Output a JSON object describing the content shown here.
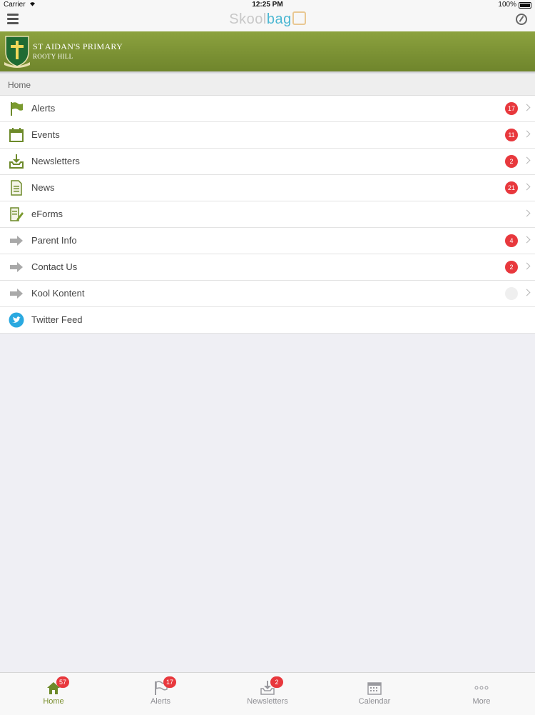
{
  "status_bar": {
    "carrier": "Carrier",
    "time": "12:25 PM",
    "battery": "100%"
  },
  "header": {
    "logo_part1": "Skool",
    "logo_part2": "bag"
  },
  "school": {
    "name": "ST AIDAN'S PRIMARY",
    "location": "ROOTY HILL"
  },
  "breadcrumb": "Home",
  "menu": [
    {
      "label": "Alerts",
      "badge": "17",
      "icon": "flag-icon"
    },
    {
      "label": "Events",
      "badge": "11",
      "icon": "calendar-icon"
    },
    {
      "label": "Newsletters",
      "badge": "2",
      "icon": "inbox-download-icon"
    },
    {
      "label": "News",
      "badge": "21",
      "icon": "document-icon"
    },
    {
      "label": "eForms",
      "badge": "",
      "icon": "form-edit-icon"
    },
    {
      "label": "Parent Info",
      "badge": "4",
      "icon": "arrow-right-icon"
    },
    {
      "label": "Contact Us",
      "badge": "2",
      "icon": "arrow-right-icon"
    },
    {
      "label": "Kool Kontent",
      "badge": "",
      "icon": "arrow-right-icon"
    },
    {
      "label": "Twitter Feed",
      "badge": "",
      "icon": "twitter-bird-icon"
    }
  ],
  "tabbar": [
    {
      "label": "Home",
      "badge": "57",
      "icon": "home-icon"
    },
    {
      "label": "Alerts",
      "badge": "17",
      "icon": "flag-icon"
    },
    {
      "label": "Newsletters",
      "badge": "2",
      "icon": "inbox-download-icon"
    },
    {
      "label": "Calendar",
      "badge": "",
      "icon": "calendar-icon"
    },
    {
      "label": "More",
      "badge": "",
      "icon": "more-dots-icon"
    }
  ],
  "colors": {
    "school_green": "#7a9033",
    "badge_red": "#e8383d",
    "logo_blue": "#4bb7d2"
  }
}
